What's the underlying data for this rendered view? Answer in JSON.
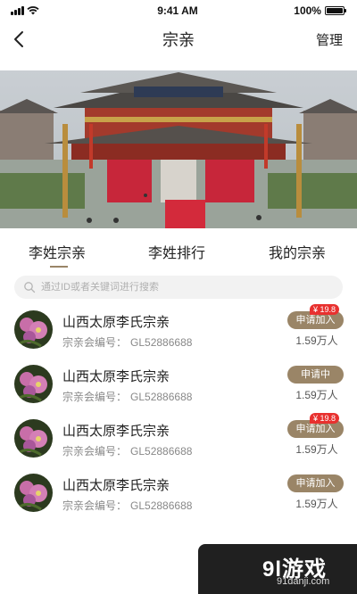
{
  "status_bar": {
    "time": "9:41 AM",
    "battery": "100%"
  },
  "nav": {
    "title": "宗亲",
    "manage_label": "管理"
  },
  "banner": {
    "image": "temple-gathering-photo"
  },
  "tabs": [
    {
      "label": "李姓宗亲",
      "active": true
    },
    {
      "label": "李姓排行",
      "active": false
    },
    {
      "label": "我的宗亲",
      "active": false
    }
  ],
  "search": {
    "placeholder": "通过ID或者关键词进行搜索"
  },
  "list": [
    {
      "name": "山西太原李氏宗亲",
      "code_label": "宗亲会编号：",
      "code": "GL52886688",
      "action": "申请加入",
      "price": "¥ 19.8",
      "members": "1.59万人"
    },
    {
      "name": "山西太原李氏宗亲",
      "code_label": "宗亲会编号：",
      "code": "GL52886688",
      "action": "申请中",
      "price": "",
      "members": "1.59万人"
    },
    {
      "name": "山西太原李氏宗亲",
      "code_label": "宗亲会编号：",
      "code": "GL52886688",
      "action": "申请加入",
      "price": "¥ 19.8",
      "members": "1.59万人"
    },
    {
      "name": "山西太原李氏宗亲",
      "code_label": "宗亲会编号：",
      "code": "GL52886688",
      "action": "申请加入",
      "price": "",
      "members": "1.59万人"
    }
  ],
  "watermark": {
    "logo": "9l游戏",
    "url": "91danji.com"
  },
  "colors": {
    "accent": "#9a8567",
    "badge": "#e8312f",
    "search_bg": "#f2f2f2"
  }
}
